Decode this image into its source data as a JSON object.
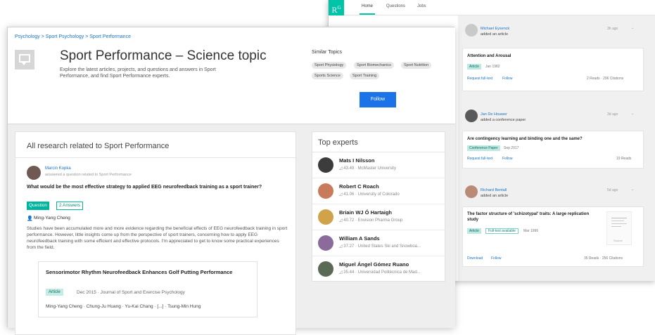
{
  "bg_window": {
    "logo": "R",
    "logo_sup": "G",
    "nav": [
      "Home",
      "Questions",
      "Jobs"
    ],
    "feed": [
      {
        "author": "Michael Eysenck",
        "action": "added an article",
        "time": "3h ago",
        "title": "Attention and Arousal",
        "tag": "Article",
        "date": "Jan 1982",
        "links": [
          "Request full-text",
          "Follow"
        ],
        "stats": "2 Reads · 296 Citations"
      },
      {
        "author": "Jan De Houwer",
        "action": "added a conference paper",
        "time": "3d ago",
        "title": "Are contingency learning and binding one and the same?",
        "tag": "Conference Paper",
        "date": "Sep 2017",
        "links": [
          "Request full-text",
          "Follow"
        ],
        "stats": "19 Reads"
      },
      {
        "author": "Richard Bentall",
        "action": "added an article",
        "time": "5d ago",
        "title": "The factor structure of 'schizotypal' traits: A large replication study",
        "tag": "Article",
        "tag2": "Full-text available",
        "date": "Mar 1996",
        "links": [
          "Download",
          "Follow"
        ],
        "stats": "35 Reads · 256 Citations",
        "thumb_caption": "Source"
      }
    ]
  },
  "header": {
    "breadcrumb": "Psychology > Sport Psychology > Sport Performance",
    "title": "Sport Performance – Science topic",
    "description": "Explore the latest articles, projects, and questions and answers in Sport Performance, and find Sport Performance experts.",
    "similar_label": "Similar Topics",
    "similar_topics": [
      "Sport Physiology",
      "Sport Biomechanics",
      "Sport Nutrition",
      "Sports Science",
      "Sport Training"
    ],
    "follow_label": "Follow"
  },
  "research": {
    "title": "All research related to Sport Performance",
    "question": {
      "author": "Marcin Kopka",
      "action": "answered a question related to Sport Performance",
      "title": "What would be the most effective strategy to applied EEG neurofeedback training as a sport trainer?",
      "tag": "Question",
      "answers": "2 Answers",
      "user": "Ming-Yang Cheng",
      "body": "Studies have been accumulated more and more evidence regarding the beneficial effects of EEG neurofeedback training in sport performance. However, little insights come up from the perspective of sport trainers, concerning how to apply EEG neurofeedback training with some efficient and effective protocols. I'm appreciated to get to know some practical experiences from the field."
    },
    "article": {
      "title": "Sensorimotor Rhythm Neurofeedback Enhances Golf Putting Performance",
      "tag": "Article",
      "meta": "Dec 2015 · Journal of Sport and Exercise Psychology",
      "authors": "Ming-Yang Cheng · Chung-Ju Huang · Yu-Kai Chang · [...] · Tsung-Min Hung"
    }
  },
  "experts": {
    "title": "Top experts",
    "list": [
      {
        "name": "Mats I Nilsson",
        "meta": "43.49 · McMaster University"
      },
      {
        "name": "Robert C Roach",
        "meta": "41.06 · University of Colorado"
      },
      {
        "name": "Briain WJ Ó Hartaigh",
        "meta": "40.72 · Envision Pharma Group"
      },
      {
        "name": "William A Sands",
        "meta": "37.27 · United States Ski and Snowboa..."
      },
      {
        "name": "Miguel Ángel Gómez Ruano",
        "meta": "35.44 · Universidad Politécnica de Mad..."
      }
    ]
  },
  "colors": {
    "accent_teal": "#00b59d",
    "link_blue": "#1a73c2",
    "follow_button": "#1a73e8"
  }
}
